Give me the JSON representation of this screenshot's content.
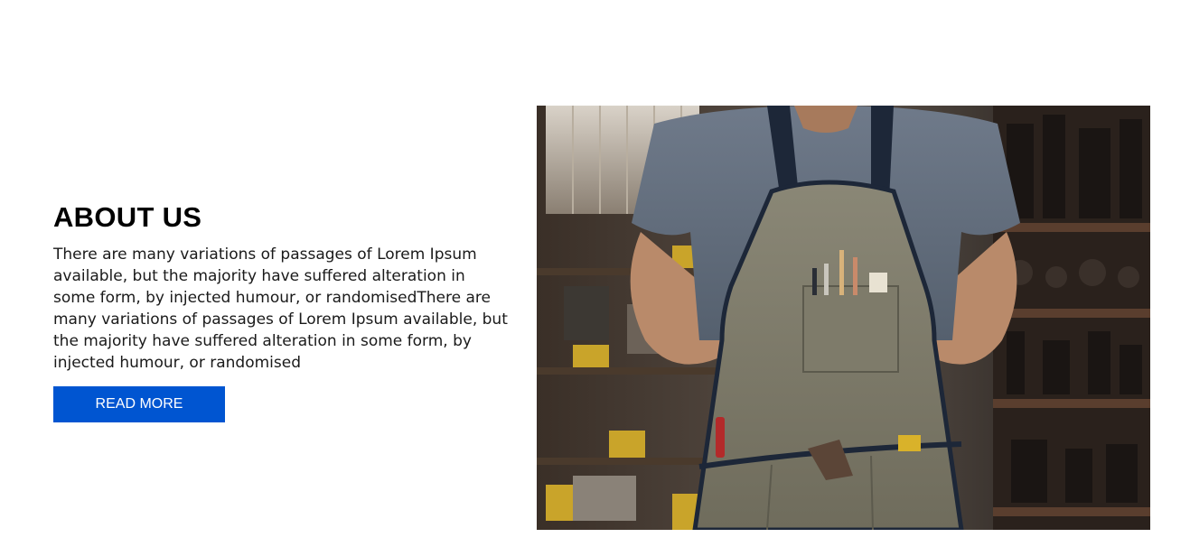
{
  "about": {
    "title": "ABOUT US",
    "body": "There are many variations of passages of Lorem Ipsum available, but the majority have suffered alteration in some form, by injected humour, or randomisedThere are many variations of passages of Lorem Ipsum available, but the majority have suffered alteration in some form, by injected humour, or randomised",
    "button_label": "READ MORE"
  },
  "colors": {
    "button_bg": "#0055d1",
    "button_text": "#ffffff",
    "title": "#000000"
  }
}
